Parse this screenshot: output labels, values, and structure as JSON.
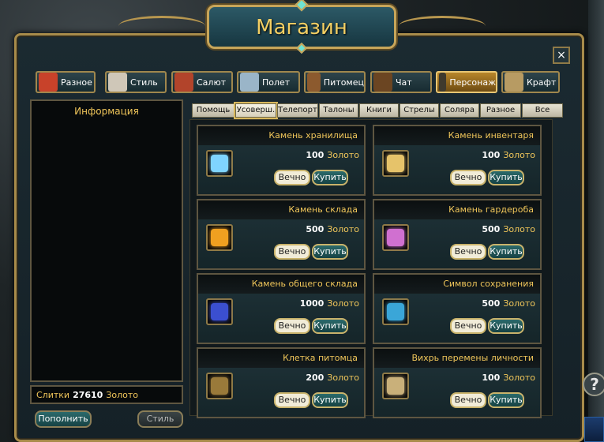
{
  "window": {
    "title": "Магазин",
    "close_label": "×"
  },
  "categories": [
    {
      "label": "Разное",
      "icon": "gift-box-icon",
      "color": "#c8422a"
    },
    {
      "label": "Стиль",
      "icon": "armor-costume-icon",
      "color": "#cfc7b8"
    },
    {
      "label": "Салют",
      "icon": "firework-barrel-icon",
      "color": "#b2442b"
    },
    {
      "label": "Полет",
      "icon": "flying-sword-icon",
      "color": "#9ab5c8"
    },
    {
      "label": "Питомец",
      "icon": "horse-head-icon",
      "color": "#8c5a2e"
    },
    {
      "label": "Чат",
      "icon": "chat-item-icon",
      "color": "#6b4522"
    },
    {
      "label": "Персонаж",
      "icon": "character-scroll-icon",
      "color": "#3f3a2d",
      "active": true
    },
    {
      "label": "Крафт",
      "icon": "craft-scroll-icon",
      "color": "#b79b63"
    }
  ],
  "info_panel": {
    "title": "Информация"
  },
  "balance": {
    "label": "Слитки",
    "amount": "27610",
    "currency": "Золото"
  },
  "buttons": {
    "topup": "Пополнить",
    "style": "Стиль"
  },
  "subtabs": [
    {
      "label": "Помощь"
    },
    {
      "label": "Усоверш.",
      "active": true
    },
    {
      "label": "Телепорт"
    },
    {
      "label": "Талоны"
    },
    {
      "label": "Книги"
    },
    {
      "label": "Стрелы"
    },
    {
      "label": "Соляра"
    },
    {
      "label": "Разное"
    },
    {
      "label": "Все"
    }
  ],
  "items": [
    {
      "name": "Камень хранилища",
      "price": "100",
      "currency": "Золото",
      "duration": "Вечно",
      "buy": "Купить",
      "icon": "storage-crystal-icon",
      "color": "#7fd4ff"
    },
    {
      "name": "Камень инвентаря",
      "price": "100",
      "currency": "Золото",
      "duration": "Вечно",
      "buy": "Купить",
      "icon": "inventory-stone-icon",
      "color": "#e6c36a"
    },
    {
      "name": "Камень склада",
      "price": "500",
      "currency": "Золото",
      "duration": "Вечно",
      "buy": "Купить",
      "icon": "warehouse-stone-icon",
      "color": "#f0a020"
    },
    {
      "name": "Камень гардероба",
      "price": "500",
      "currency": "Золото",
      "duration": "Вечно",
      "buy": "Купить",
      "icon": "wardrobe-stone-icon",
      "color": "#d070d0"
    },
    {
      "name": "Камень общего склада",
      "price": "1000",
      "currency": "Золото",
      "duration": "Вечно",
      "buy": "Купить",
      "icon": "shared-storage-orb-icon",
      "color": "#3b4fd0"
    },
    {
      "name": "Символ сохранения",
      "price": "500",
      "currency": "Золото",
      "duration": "Вечно",
      "buy": "Купить",
      "icon": "save-symbol-icon",
      "color": "#3aa6d8"
    },
    {
      "name": "Клетка питомца",
      "price": "200",
      "currency": "Золото",
      "duration": "Вечно",
      "buy": "Купить",
      "icon": "pet-cage-icon",
      "color": "#9a7a3a"
    },
    {
      "name": "Вихрь перемены личности",
      "price": "100",
      "currency": "Золото",
      "duration": "Вечно",
      "buy": "Купить",
      "icon": "identity-change-scroll-icon",
      "color": "#c9b07a"
    }
  ]
}
